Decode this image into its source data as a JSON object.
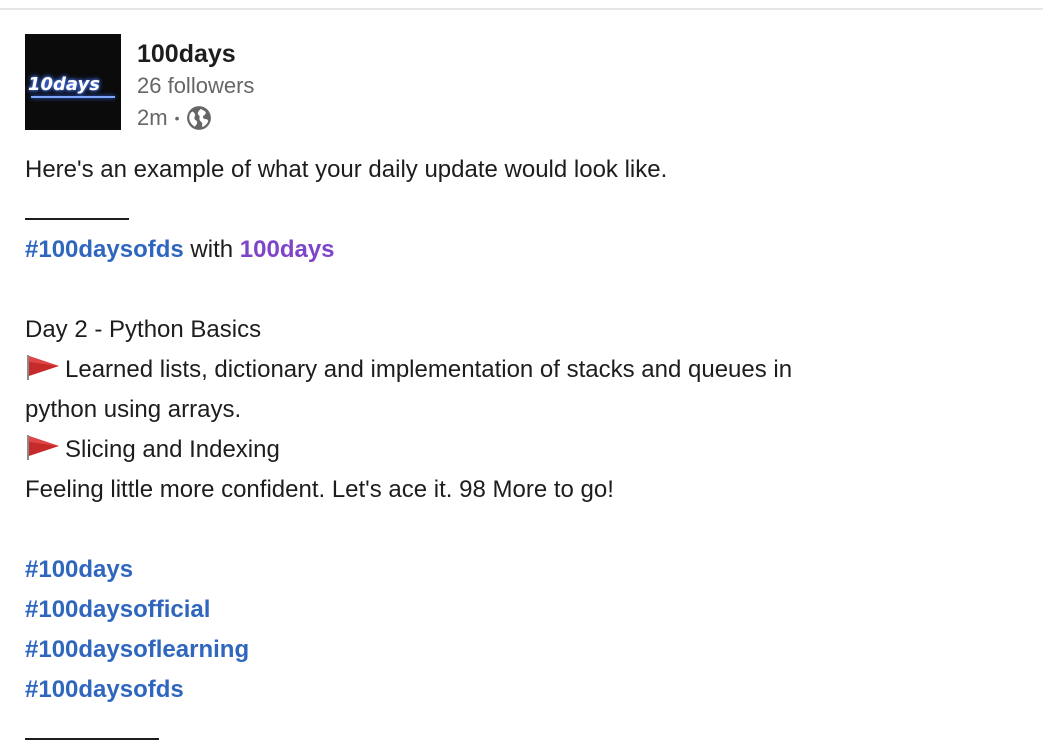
{
  "post": {
    "author": {
      "name": "100days",
      "followers": "26 followers",
      "time": "2m",
      "separator": "•",
      "visibility_icon": "globe-icon",
      "avatar_logo": "10days"
    },
    "body": {
      "intro": "Here's an example of what your daily update would look like.",
      "tag_line": {
        "hashtag": "#100daysofds",
        "connector": " with ",
        "mention": "100days"
      },
      "day_title": "Day 2 - Python Basics",
      "bullets": [
        "Learned lists, dictionary and implementation of stacks and queues in",
        "python using arrays.",
        "Slicing and Indexing"
      ],
      "closing": "Feeling little more confident. Let's ace it. 98 More to go!",
      "hashtags": [
        "#100days",
        "#100daysofficial",
        "#100daysoflearning",
        "#100daysofds"
      ],
      "bullet_icon": "red-flag-icon"
    },
    "colors": {
      "hashtag": "#2f67bf",
      "mention": "#7e45c9",
      "muted": "#666666"
    }
  }
}
